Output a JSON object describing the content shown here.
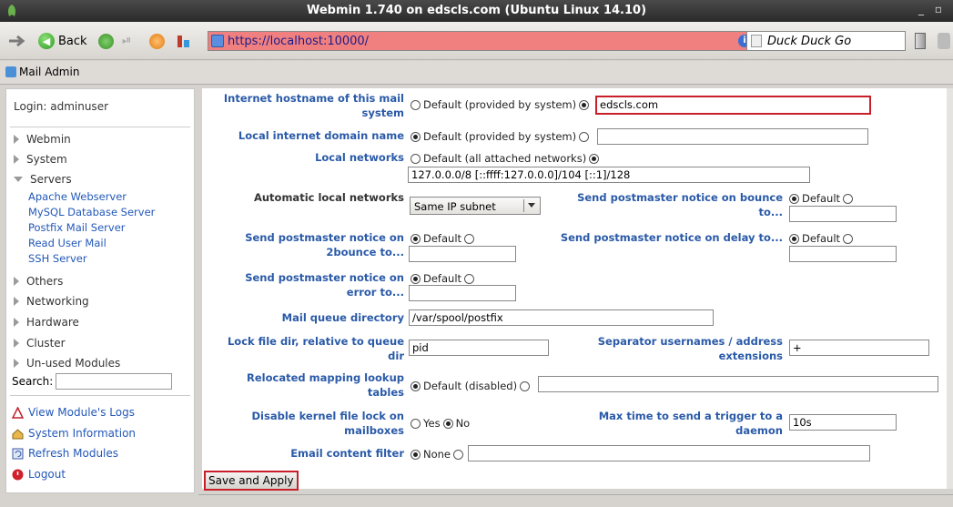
{
  "window": {
    "title": "Webmin 1.740 on edscls.com (Ubuntu Linux 14.10)",
    "controls": "_ ▫"
  },
  "nav": {
    "back_label": "Back",
    "url": "https://localhost:10000/",
    "search_placeholder": "Duck Duck Go",
    "url_bar_color": "#f08080"
  },
  "tab": {
    "label": "Mail Admin",
    "icon": "mail-admin-icon"
  },
  "sidebar": {
    "login": "Login: adminuser",
    "categories": [
      {
        "label": "Webmin",
        "expanded": false
      },
      {
        "label": "System",
        "expanded": false
      },
      {
        "label": "Servers",
        "expanded": true
      },
      {
        "label": "Others",
        "expanded": false
      },
      {
        "label": "Networking",
        "expanded": false
      },
      {
        "label": "Hardware",
        "expanded": false
      },
      {
        "label": "Cluster",
        "expanded": false
      },
      {
        "label": "Un-used Modules",
        "expanded": false
      }
    ],
    "servers": [
      "Apache Webserver",
      "MySQL Database Server",
      "Postfix Mail Server",
      "Read User Mail",
      "SSH Server"
    ],
    "search_label": "Search:",
    "links": [
      {
        "label": "View Module's Logs",
        "icon": "warning-icon"
      },
      {
        "label": "System Information",
        "icon": "home-icon"
      },
      {
        "label": "Refresh Modules",
        "icon": "refresh-icon"
      },
      {
        "label": "Logout",
        "icon": "power-icon"
      }
    ]
  },
  "form": {
    "hostname": {
      "label1": "Internet hostname of this mail",
      "label2": "system",
      "default_opt": "Default (provided by system)",
      "value": "edscls.com"
    },
    "domain": {
      "label": "Local internet domain name",
      "default_opt": "Default (provided by system)",
      "value": ""
    },
    "networks": {
      "label": "Local networks",
      "default_opt": "Default (all attached networks)",
      "value": "127.0.0.0/8 [::ffff:127.0.0.0]/104 [::1]/128"
    },
    "auto_networks": {
      "label": "Automatic local networks",
      "value": "Same IP subnet"
    },
    "bounce": {
      "label1": "Send postmaster notice on bounce",
      "label2": "to...",
      "default_opt": "Default",
      "value": ""
    },
    "bounce2": {
      "label1": "Send postmaster notice on",
      "label2": "2bounce to...",
      "default_opt": "Default",
      "value": ""
    },
    "delay": {
      "label": "Send postmaster notice on delay to...",
      "default_opt": "Default",
      "value": ""
    },
    "error": {
      "label1": "Send postmaster notice on",
      "label2": "error to...",
      "default_opt": "Default",
      "value": ""
    },
    "queue_dir": {
      "label": "Mail queue directory",
      "value": "/var/spool/postfix"
    },
    "lock_dir": {
      "label1": "Lock file dir, relative to queue",
      "label2": "dir",
      "value": "pid"
    },
    "separator": {
      "label1": "Separator usernames / address",
      "label2": "extensions",
      "value": "+"
    },
    "relocated": {
      "label1": "Relocated mapping lookup",
      "label2": "tables",
      "default_opt": "Default (disabled)",
      "value": ""
    },
    "kernel_lock": {
      "label1": "Disable kernel file lock on",
      "label2": "mailboxes",
      "yes": "Yes",
      "no": "No"
    },
    "trigger": {
      "label1": "Max time to send a trigger to a",
      "label2": "daemon",
      "value": "10s"
    },
    "filter": {
      "label": "Email content filter",
      "none_opt": "None",
      "value": ""
    },
    "save_label": "Save and Apply"
  }
}
